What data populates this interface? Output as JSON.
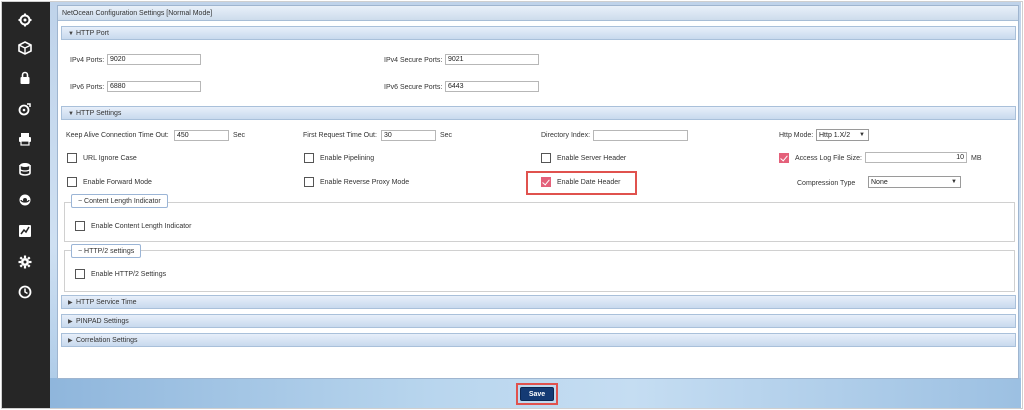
{
  "window": {
    "title": "NetOcean Configuration Settings [Normal Mode]"
  },
  "sidebar": {
    "items": [
      {
        "icon": "gear-network-icon"
      },
      {
        "icon": "cube-icon"
      },
      {
        "icon": "lock-icon"
      },
      {
        "icon": "gear-timer-icon"
      },
      {
        "icon": "printer-icon"
      },
      {
        "icon": "database-icon"
      },
      {
        "icon": "globe-icon"
      },
      {
        "icon": "chart-icon"
      },
      {
        "icon": "settings-icon"
      },
      {
        "icon": "clock-icon"
      }
    ]
  },
  "http_port": {
    "title": "HTTP Port",
    "ipv4_ports_label": "IPv4 Ports:",
    "ipv4_ports_value": "9020",
    "ipv4_secure_label": "IPv4 Secure Ports:",
    "ipv4_secure_value": "9021",
    "ipv6_ports_label": "IPv6 Ports:",
    "ipv6_ports_value": "6880",
    "ipv6_secure_label": "IPv6 Secure Ports:",
    "ipv6_secure_value": "6443"
  },
  "http_settings": {
    "title": "HTTP Settings",
    "keep_alive_label": "Keep Alive Connection Time Out:",
    "keep_alive_value": "450",
    "keep_alive_unit": "Sec",
    "first_request_label": "First Request Time Out:",
    "first_request_value": "30",
    "first_request_unit": "Sec",
    "directory_index_label": "Directory Index:",
    "directory_index_value": "",
    "http_mode_label": "Http Mode:",
    "http_mode_value": "Http 1.X/2",
    "url_ignore_case": {
      "label": "URL Ignore Case",
      "checked": false
    },
    "enable_pipelining": {
      "label": "Enable Pipelining",
      "checked": false
    },
    "enable_server_header": {
      "label": "Enable Server Header",
      "checked": false
    },
    "access_log_file_size": {
      "label": "Access Log File Size:",
      "checked": true,
      "value": "10",
      "unit": "MB"
    },
    "enable_forward_mode": {
      "label": "Enable Forward Mode",
      "checked": false
    },
    "enable_reverse_proxy": {
      "label": "Enable Reverse Proxy Mode",
      "checked": false
    },
    "enable_date_header": {
      "label": "Enable Date Header",
      "checked": true
    },
    "compression_type_label": "Compression Type",
    "compression_type_value": "None",
    "content_length_group": {
      "legend": "− Content Length Indicator",
      "checkbox_label": "Enable Content Length Indicator",
      "checked": false
    },
    "http2_group": {
      "legend": "− HTTP/2 settings",
      "checkbox_label": "Enable HTTP/2 Settings",
      "checked": false
    }
  },
  "collapsed_sections": [
    {
      "title": "HTTP Service Time"
    },
    {
      "title": "PINPAD Settings"
    },
    {
      "title": "Correlation Settings"
    }
  ],
  "footer": {
    "save_label": "Save"
  },
  "colors": {
    "accent_check": "#e4607a",
    "highlight": "#e0524e",
    "save_button": "#143a74"
  }
}
